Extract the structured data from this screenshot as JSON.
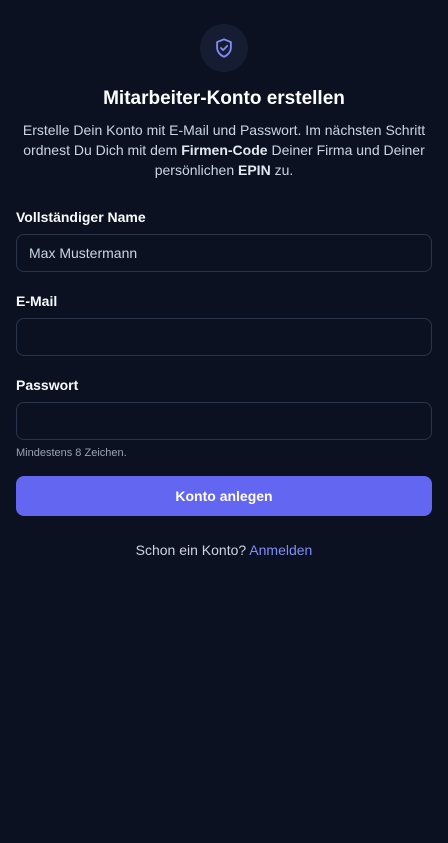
{
  "header": {
    "icon": "shield-check-icon",
    "title": "Mitarbeiter-Konto erstellen",
    "intro": {
      "part1": "Erstelle Dein Konto mit E-Mail und Passwort. Im nächsten Schritt ordnest Du Dich mit dem ",
      "firmen_code": "Firmen-Code",
      "part2": " Deiner Firma und Deiner persönlichen ",
      "epin": "EPIN",
      "part3": " zu."
    }
  },
  "form": {
    "name": {
      "label": "Vollständiger Name",
      "placeholder": "Max Mustermann",
      "value": ""
    },
    "email": {
      "label": "E-Mail",
      "placeholder": "",
      "value": ""
    },
    "password": {
      "label": "Passwort",
      "placeholder": "",
      "value": "",
      "hint": "Mindestens 8 Zeichen."
    },
    "submit_label": "Konto anlegen"
  },
  "footer": {
    "text": "Schon ein Konto? ",
    "link_label": "Anmelden"
  },
  "colors": {
    "background": "#0b1120",
    "accent": "#6366f1",
    "link": "#818cf8",
    "field_border": "#2a3448"
  }
}
